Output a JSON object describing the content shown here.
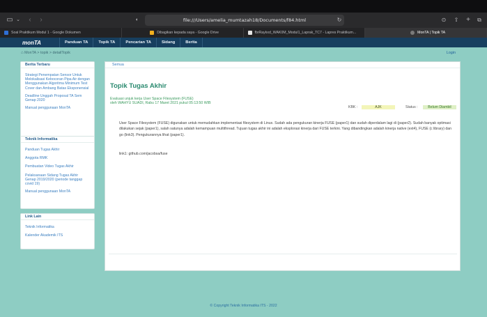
{
  "browser": {
    "address": "file:///Users/amelia_mumtazah18/Documents/f84.html",
    "tabs": [
      {
        "label": "Soal Praktikum Modul 1 - Google Dokumen",
        "favcolor": "#2f6fd6"
      },
      {
        "label": "Dibagikan kepada saya - Google Drive",
        "favcolor": "#f2b01e"
      },
      {
        "label": "fbrRaykxd_WAK0M_Modul1_Laprak_TC7 - Lapres Praktikum...",
        "favcolor": "#e6e6e6"
      },
      {
        "label": "MonTA | Topik TA",
        "favcolor": "#7a7a7a",
        "active": true
      }
    ]
  },
  "site": {
    "brand": "monTA",
    "menu": [
      "Panduan TA",
      "Topik TA",
      "Pencarian TA",
      "Sidang",
      "Berita"
    ],
    "breadcrumb": "MonTA > topik > detailTopik",
    "login": "Login",
    "berita": {
      "title": "Berita Terbaru",
      "items": [
        "Strategi Penempatan Sensor Untuk Melokalisasi Kebocoran Pipa Air dengan Menggunakan Algoritma Minimum Test Cover dan Ambang Batas Eksponensial",
        "Deadline Unggah Proposal TA Sem Genap 2020",
        "Manual penggunaan MonTA"
      ]
    },
    "teknik": {
      "title": "Teknik Informatika",
      "items": [
        "Panduan Tugas Akhir",
        "Anggota RMK",
        "Pembuatan Video Tugas Akhir",
        "Pelaksanaan Sidang Tugas Akhir Genap 2019/2020 (periode tanggap covid 19)",
        "Manual penggunaan MonTA"
      ]
    },
    "links": {
      "title": "Link Lain",
      "items": [
        "Teknik Informatika",
        "Kalender Akademik ITS"
      ]
    },
    "detail": {
      "tab": "Semua",
      "title": "Topik Tugas Akhir",
      "subtitle": "Evaluasi unjuk kerja User Space Filesystem (FUSE)",
      "byline": "oleh WAHYU SUADI, Rabu 17 Maret 2021 pukul 05:13:50 WIB",
      "kbk_label": "KBK :",
      "kbk_value": "AJK",
      "status_label": "Status :",
      "status_value": "Belum Diambil",
      "body": "User Space Filesystem (FUSE) digunakan untuk memudahkan implementasi filesystem di Linux. Sudah ada pengukuran kinerja FUSE (paper1) dan sudah diperdalam lagi di (paper2). Sudah banyak optimasi dilakukan sejak (paper1), salah satunya adalah kemampuan multithread. Tujuan tugas akhir ini adalah eksplorasi kinerja dari FUSE terkini. Yang dibandingkan adalah kinerja native (ext4), FUSE (c library) dan go (link3). Pengukurannya lihat (paper1).",
      "link": "link1: github.com/jacobsa/fuse"
    },
    "footer": "© Copyright Teknik Informatika ITS - 2022"
  },
  "colors": {
    "nav": "#173f5f",
    "background": "#8ecdc3",
    "title": "#2a8a6f",
    "kbk_pill": "#f3f5b8",
    "status_pill": "#dff0c6"
  }
}
